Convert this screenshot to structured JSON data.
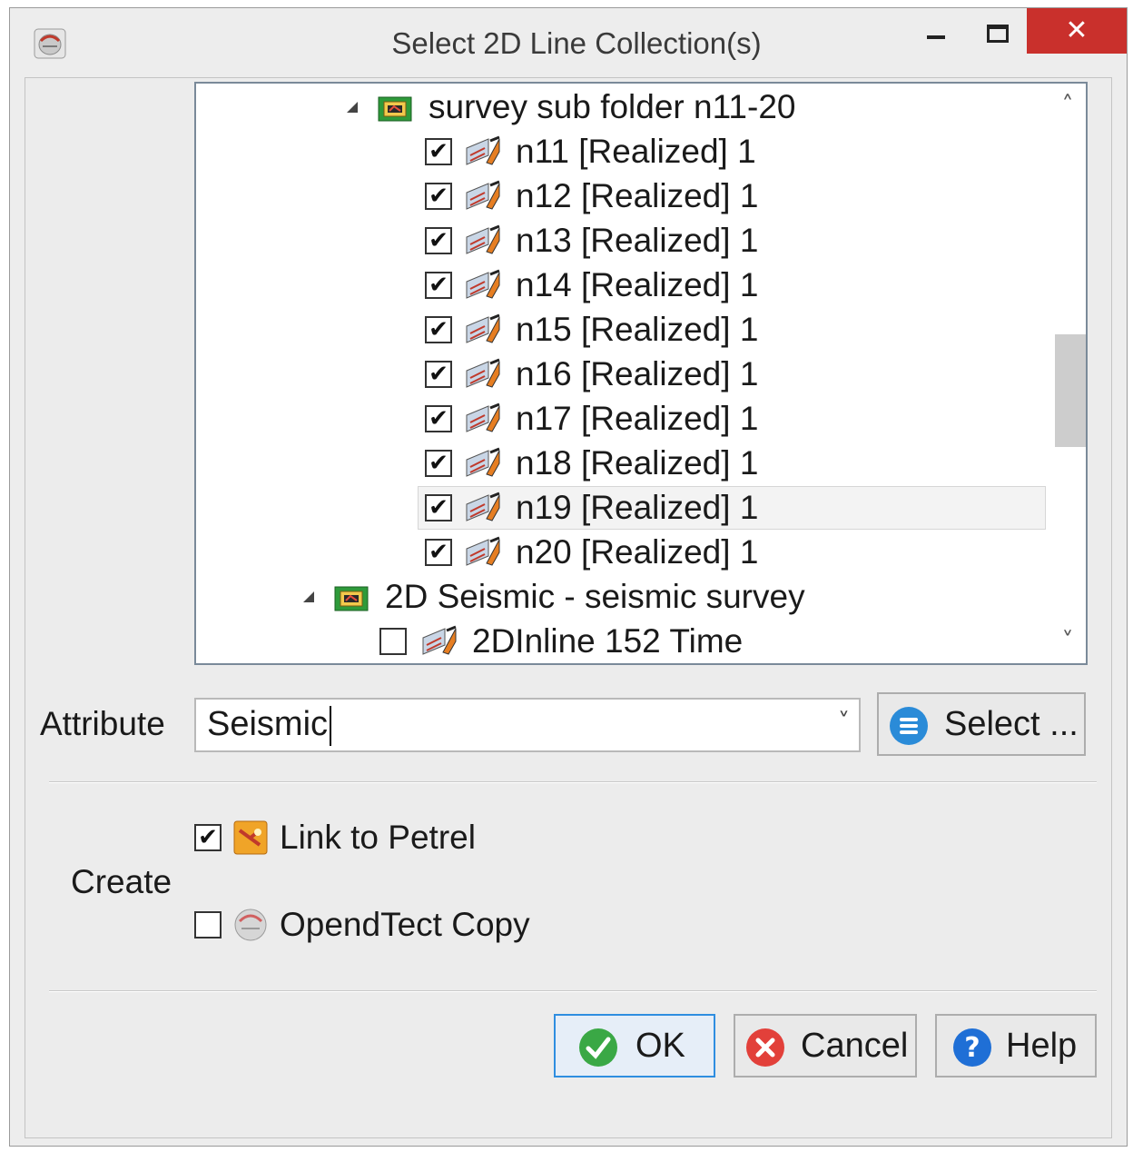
{
  "window": {
    "title": "Select 2D Line Collection(s)",
    "close_glyph": "✕"
  },
  "tree": {
    "rows": [
      {
        "label": "survey sub folder n11-20",
        "kind": "folder",
        "expanded": true,
        "checked": null
      },
      {
        "label": "n11 [Realized] 1",
        "kind": "line",
        "checked": true
      },
      {
        "label": "n12 [Realized] 1",
        "kind": "line",
        "checked": true
      },
      {
        "label": "n13 [Realized] 1",
        "kind": "line",
        "checked": true
      },
      {
        "label": "n14 [Realized] 1",
        "kind": "line",
        "checked": true
      },
      {
        "label": "n15 [Realized] 1",
        "kind": "line",
        "checked": true
      },
      {
        "label": "n16 [Realized] 1",
        "kind": "line",
        "checked": true
      },
      {
        "label": "n17 [Realized] 1",
        "kind": "line",
        "checked": true
      },
      {
        "label": "n18 [Realized] 1",
        "kind": "line",
        "checked": true
      },
      {
        "label": "n19 [Realized] 1",
        "kind": "line",
        "checked": true,
        "selected": true
      },
      {
        "label": "n20 [Realized] 1",
        "kind": "line",
        "checked": true
      },
      {
        "label": "2D Seismic - seismic survey",
        "kind": "folder",
        "expanded": true,
        "checked": null
      },
      {
        "label": "2DInline 152 Time",
        "kind": "line",
        "checked": false
      }
    ],
    "scroll_up_glyph": "˄",
    "scroll_down_glyph": "˅"
  },
  "attribute": {
    "label": "Attribute",
    "value": "Seismic",
    "dropdown_glyph": "˅",
    "select_button": "Select ..."
  },
  "create": {
    "label": "Create",
    "options": [
      {
        "label": "Link to Petrel",
        "checked": true,
        "icon": "petrel-link-icon"
      },
      {
        "label": "OpendTect Copy",
        "checked": false,
        "icon": "opendtect-icon"
      }
    ]
  },
  "buttons": {
    "ok": "OK",
    "cancel": "Cancel",
    "help": "Help"
  },
  "checkmark_glyph": "✔",
  "colors": {
    "close_red": "#c9302c",
    "ok_green": "#3aa845",
    "cancel_red": "#e2403a",
    "help_blue": "#1f6fd6",
    "select_blue": "#2a8bd8"
  }
}
